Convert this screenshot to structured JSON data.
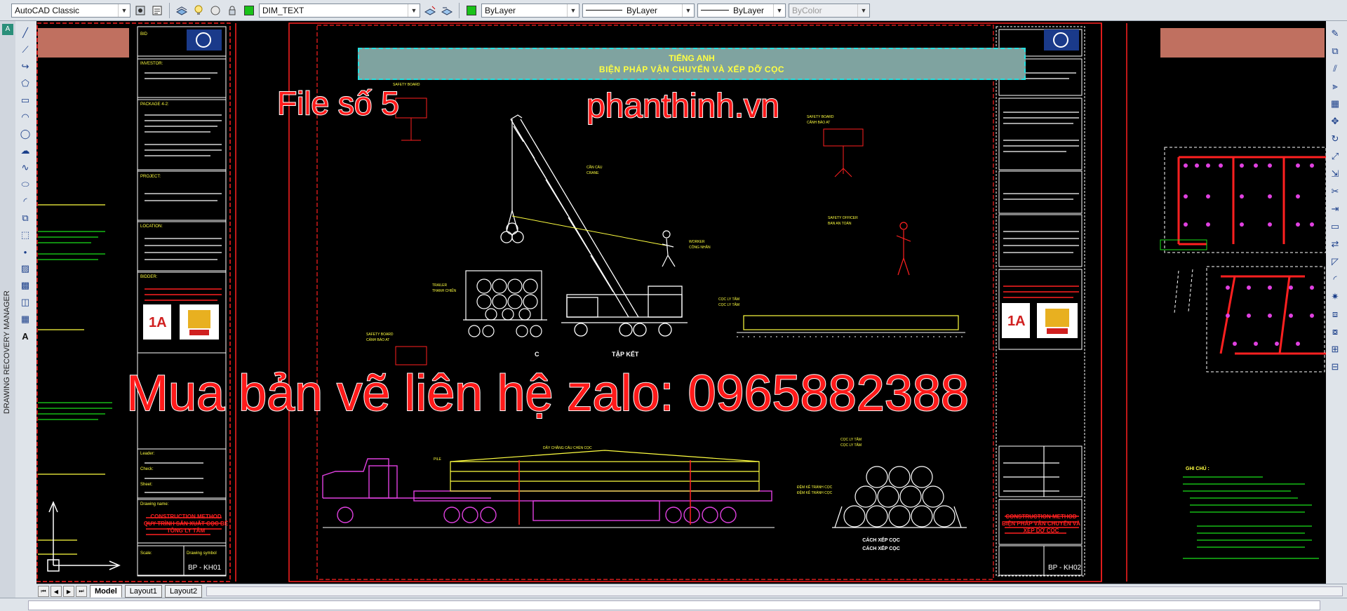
{
  "toolbar": {
    "workspace": "AutoCAD Classic",
    "layer": "DIM_TEXT",
    "color": "ByLayer",
    "linetype": "ByLayer",
    "lineweight": "ByLayer",
    "plotstyle": "ByColor",
    "layer_color": "#19c219"
  },
  "side_panel": {
    "title": "DRAWING RECOVERY MANAGER"
  },
  "tabs": {
    "model": "Model",
    "layout1": "Layout1",
    "layout2": "Layout2"
  },
  "drawing": {
    "title_line1": "TIẾNG ANH",
    "title_line2": "BIỆN PHÁP VẬN CHUYỂN VÀ XẾP DỠ CỌC",
    "crane_label": "CẦN CẨU\nCRANE",
    "worker_label": "WORKER\nCÔNG NHÂN",
    "trailer_label": "TRAILER\nTHANH CHIẾN",
    "piles_label": "CỌC LY TÂM\nCỌC LY TÂM",
    "pile_stack_caption": "CÁCH XẾP CỌC",
    "pile_stack_caption2": "CÁCH XẾP CỌC",
    "partial_caption_left": "C",
    "partial_caption_right": "TẬP KẾT",
    "drawing_symbol_left": "BP - KH01",
    "drawing_symbol_right": "BP - KH02",
    "construction_method": "CONSTRUCTION METHOD",
    "method_left": "QUY TRÌNH SẢN XUẤT CỌC BÊ TÔNG LY TÂM",
    "method_right": "BIỆN PHÁP VẬN CHUYỂN VÀ XẾP DỠ CỌC",
    "notes_title": "GHI CHÚ :",
    "panel_labels": [
      "INVESTOR:",
      "PACKAGE 4-2:",
      "PROJECT:",
      "LOCATION:",
      "BIDDER:",
      "Leader:",
      "Check:",
      "Drawing name:",
      "Drawing symbol"
    ]
  },
  "watermarks": {
    "file": "File số 5",
    "site": "phanthinh.vn",
    "contact": "Mua bản vẽ liên hệ zalo: 0965882388"
  },
  "colors": {
    "frame_red": "#ff2020",
    "panel_border": "#ffffff",
    "cad_yellow": "#ffff40",
    "cad_magenta": "#e040e0",
    "cad_green": "#19e019"
  }
}
